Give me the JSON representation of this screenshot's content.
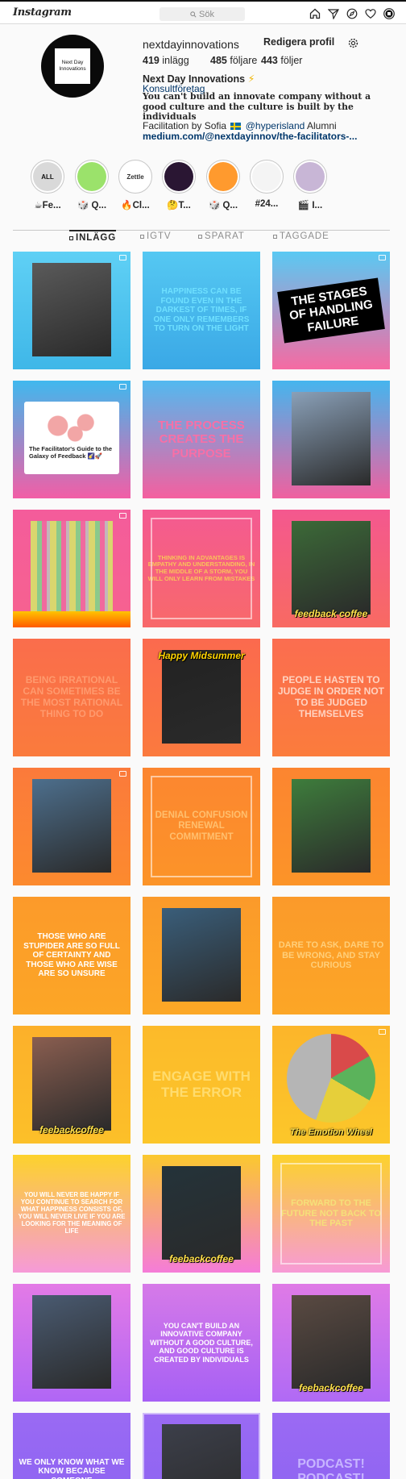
{
  "nav": {
    "logo": "Instagram",
    "search_placeholder": "Sök",
    "icons": [
      "home-icon",
      "direct-icon",
      "explore-icon",
      "activity-icon",
      "profile-avatar"
    ]
  },
  "profile": {
    "avatar_text": "Next Day Innovations",
    "username": "nextdayinnovations",
    "edit_label": "Redigera profil",
    "posts_count": "419",
    "posts_label": "inlägg",
    "followers_count": "485",
    "followers_label": "följare",
    "following_count": "443",
    "following_label": "följer",
    "full_name": "Next Day Innovations",
    "name_emoji": "⚡",
    "category": "Konsultföretag",
    "bio": "You can't build an innovate company without a good culture and the culture is built by the individuals",
    "bio_dot": ".",
    "bio_line2_prefix": "Facilitation by Sofia",
    "mention": "@hyperisland",
    "bio_line2_suffix": "Alumni",
    "link": "medium.com/@nextdayinnov/the-facilitators-..."
  },
  "highlights": [
    {
      "label": "☕Fe...",
      "thumb": "ALL",
      "bg": "#d9d9d9",
      "fg": "#111111"
    },
    {
      "label": "🎲 Q...",
      "thumb": "",
      "bg": "#9be26b",
      "fg": "#ffffff"
    },
    {
      "label": "🔥Cl...",
      "thumb": "Zettle",
      "bg": "#ffffff",
      "fg": "#333333"
    },
    {
      "label": "🤔T...",
      "thumb": "",
      "bg": "#2a1633",
      "fg": "#ff3fa0"
    },
    {
      "label": "🎲 Q...",
      "thumb": "",
      "bg": "#ff9a2e",
      "fg": "#ffffff"
    },
    {
      "label": "#24...",
      "thumb": "",
      "bg": "#f4f4f4",
      "fg": "#333333"
    },
    {
      "label": "🎬 I...",
      "thumb": "",
      "bg": "#c8b6d6",
      "fg": "#ffffff"
    }
  ],
  "tabs": [
    {
      "label": "INLÄGG",
      "active": true
    },
    {
      "label": "IGTV",
      "active": false
    },
    {
      "label": "SPARAT",
      "active": false
    },
    {
      "label": "TAGGADE",
      "active": false
    }
  ],
  "posts": [
    {
      "kind": "photo",
      "bg": [
        "#5fd0f5",
        "#3fb7e8"
      ],
      "photo": "#5a5a5a",
      "multi": true
    },
    {
      "kind": "text",
      "bg": [
        "#55c8f2",
        "#3aa8e6"
      ],
      "text": "Happiness can be found even in the darkest of times, if one only remembers to turn on the light",
      "color": "#6ee0ff",
      "size": 10
    },
    {
      "kind": "text",
      "bg": [
        "#59c9f3",
        "#f66aa2"
      ],
      "text": "The stages of handling failure",
      "color": "#ffffff",
      "size": 15,
      "boxed": true,
      "multi": true
    },
    {
      "kind": "card",
      "bg": [
        "#40b8ee",
        "#f25ea6"
      ],
      "text": "The Facilitator's Guide to the Galaxy of Feedback 🌠🚀",
      "multi": true
    },
    {
      "kind": "text",
      "bg": [
        "#52b9f0",
        "#f55f9f"
      ],
      "text": "The process creates the purpose",
      "color": "#f86fa6",
      "size": 15
    },
    {
      "kind": "photo",
      "bg": [
        "#45b5ee",
        "#f0609f"
      ],
      "photo": "#8aa0b8"
    },
    {
      "kind": "board",
      "bg": [
        "#f45c9b",
        "#f7628f"
      ],
      "multi": true
    },
    {
      "kind": "text",
      "bg": [
        "#f45a92",
        "#f8696a"
      ],
      "text": "Thinking in advantages is empathy and understanding, in the middle of a storm, you will only learn from mistakes",
      "color": "#f9c25a",
      "size": 7.5,
      "frame": true
    },
    {
      "kind": "photo",
      "bg": [
        "#f4588f",
        "#f86a62"
      ],
      "photo": "#3c6a38",
      "caption": "feedback coffee"
    },
    {
      "kind": "text",
      "bg": [
        "#fa6d4c",
        "#fa7b3c"
      ],
      "text": "Being irrational can sometimes be the most rational thing to do",
      "color": "#ff9a6e",
      "size": 12
    },
    {
      "kind": "photo",
      "bg": [
        "#fb6a4e",
        "#fb7a3e"
      ],
      "photo": "#222222",
      "caption": "Happy Midsummer"
    },
    {
      "kind": "text",
      "bg": [
        "#fb6d50",
        "#fb7c3c"
      ],
      "text": "People hasten to judge in order not to be judged themselves",
      "color": "#ffd2c0",
      "size": 12
    },
    {
      "kind": "photo",
      "bg": [
        "#fb7a3b",
        "#fc8a2e"
      ],
      "photo": "#4d6f8d",
      "multi": true
    },
    {
      "kind": "text",
      "bg": [
        "#fc8630",
        "#fc9428"
      ],
      "text": "Denial confusion renewal commitment",
      "color": "#ffbf6e",
      "size": 11.5,
      "frame": true
    },
    {
      "kind": "photo",
      "bg": [
        "#fc8530",
        "#fc9428"
      ],
      "photo": "#3e7d3c"
    },
    {
      "kind": "text",
      "bg": [
        "#fc9a2a",
        "#fca626"
      ],
      "text": "Those who are stupider are so full of certainty and those who are wise are so unsure",
      "color": "#ffffff",
      "size": 10
    },
    {
      "kind": "photo",
      "bg": [
        "#fb9a2a",
        "#fca826"
      ],
      "photo": "#3a5e7a"
    },
    {
      "kind": "text",
      "bg": [
        "#fb9a2a",
        "#fca626"
      ],
      "text": "Dare to ask, dare to be wrong, and stay curious",
      "color": "#ffcf7a",
      "size": 11
    },
    {
      "kind": "photo",
      "bg": [
        "#fcb02a",
        "#fcc029"
      ],
      "photo": "#8a5e50",
      "caption": "feebackcoffee"
    },
    {
      "kind": "text",
      "bg": [
        "#fcba2a",
        "#fcc629"
      ],
      "text": "Engage with the error",
      "color": "#ffdc6e",
      "size": 17
    },
    {
      "kind": "wheel",
      "bg": [
        "#fcb52a",
        "#fcc72a"
      ],
      "caption": "The Emotion Wheel",
      "multi": true
    },
    {
      "kind": "text",
      "bg": [
        "#fdd22c",
        "#f69ad8"
      ],
      "text": "You will never be happy if you continue to search for what happiness consists of, you will never live if you are looking for the meaning of life",
      "color": "#ffffff",
      "size": 7.8
    },
    {
      "kind": "photo",
      "bg": [
        "#fbc82e",
        "#f57cd8"
      ],
      "photo": "#24333a",
      "caption": "feebackcoffee"
    },
    {
      "kind": "text",
      "bg": [
        "#fcd22c",
        "#f79ad6"
      ],
      "text": "Forward to the future not back to the past",
      "color": "#f5e07a",
      "size": 11,
      "frame": true
    },
    {
      "kind": "photo",
      "bg": [
        "#e37ae6",
        "#b066f5"
      ],
      "photo": "#4a5b72"
    },
    {
      "kind": "text",
      "bg": [
        "#d67ae8",
        "#a660f5"
      ],
      "text": "You can't build an innovative company without a good culture, and good culture is created by individuals",
      "color": "#ffffff",
      "size": 9
    },
    {
      "kind": "photo",
      "bg": [
        "#df7ae6",
        "#b06af5"
      ],
      "photo": "#5a4a42",
      "caption": "feebackcoffee"
    },
    {
      "kind": "text",
      "bg": [
        "#9a6af3",
        "#8a62f2"
      ],
      "text": "We only know what we know because someone",
      "color": "#ffffff",
      "size": 10
    },
    {
      "kind": "photo",
      "bg": [
        "#9a6af3",
        "#8a62f2"
      ],
      "photo": "#3c3f4a",
      "frame": true
    },
    {
      "kind": "text",
      "bg": [
        "#9b6af3",
        "#8a62f2"
      ],
      "text": "Podcast! Podcast!",
      "color": "#c7b5ff",
      "size": 16
    }
  ]
}
